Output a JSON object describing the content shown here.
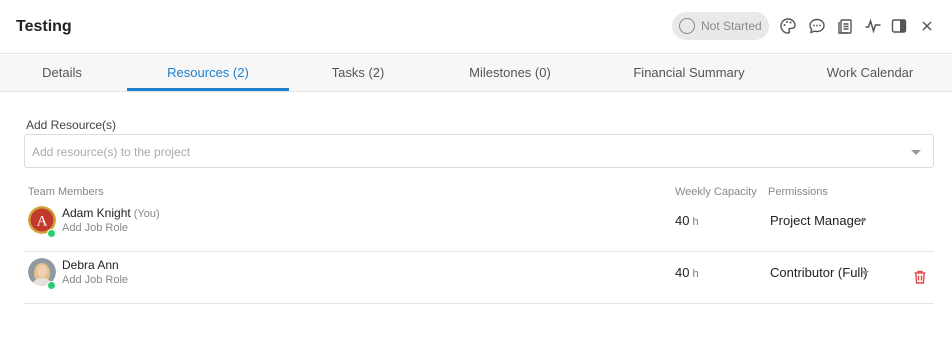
{
  "header": {
    "title": "Testing",
    "status": "Not Started",
    "icons": [
      "palette-icon",
      "comment-icon",
      "copy-icon",
      "activity-icon",
      "panel-icon",
      "close-icon"
    ]
  },
  "tabs": [
    {
      "label": "Details",
      "active": false
    },
    {
      "label": "Resources (2)",
      "active": true
    },
    {
      "label": "Tasks (2)",
      "active": false
    },
    {
      "label": "Milestones (0)",
      "active": false
    },
    {
      "label": "Financial Summary",
      "active": false
    },
    {
      "label": "Work Calendar",
      "active": false
    }
  ],
  "resources": {
    "label": "Add Resource(s)",
    "placeholder": "Add resource(s) to the project"
  },
  "table": {
    "headers": {
      "members": "Team Members",
      "capacity": "Weekly Capacity",
      "permissions": "Permissions"
    },
    "rows": [
      {
        "name": "Adam Knight",
        "you": "(You)",
        "job_role": "Add Job Role",
        "capacity": "40",
        "unit": "h",
        "permission": "Project Manager",
        "avatar_letter": "A",
        "online": true
      },
      {
        "name": "Debra Ann",
        "you": "",
        "job_role": "Add Job Role",
        "capacity": "40",
        "unit": "h",
        "permission": "Contributor (Full)",
        "online": true,
        "deletable": true
      }
    ]
  },
  "colors": {
    "accent": "#1e7fcf",
    "delete": "#e04a4a",
    "online": "#2ecc71"
  }
}
